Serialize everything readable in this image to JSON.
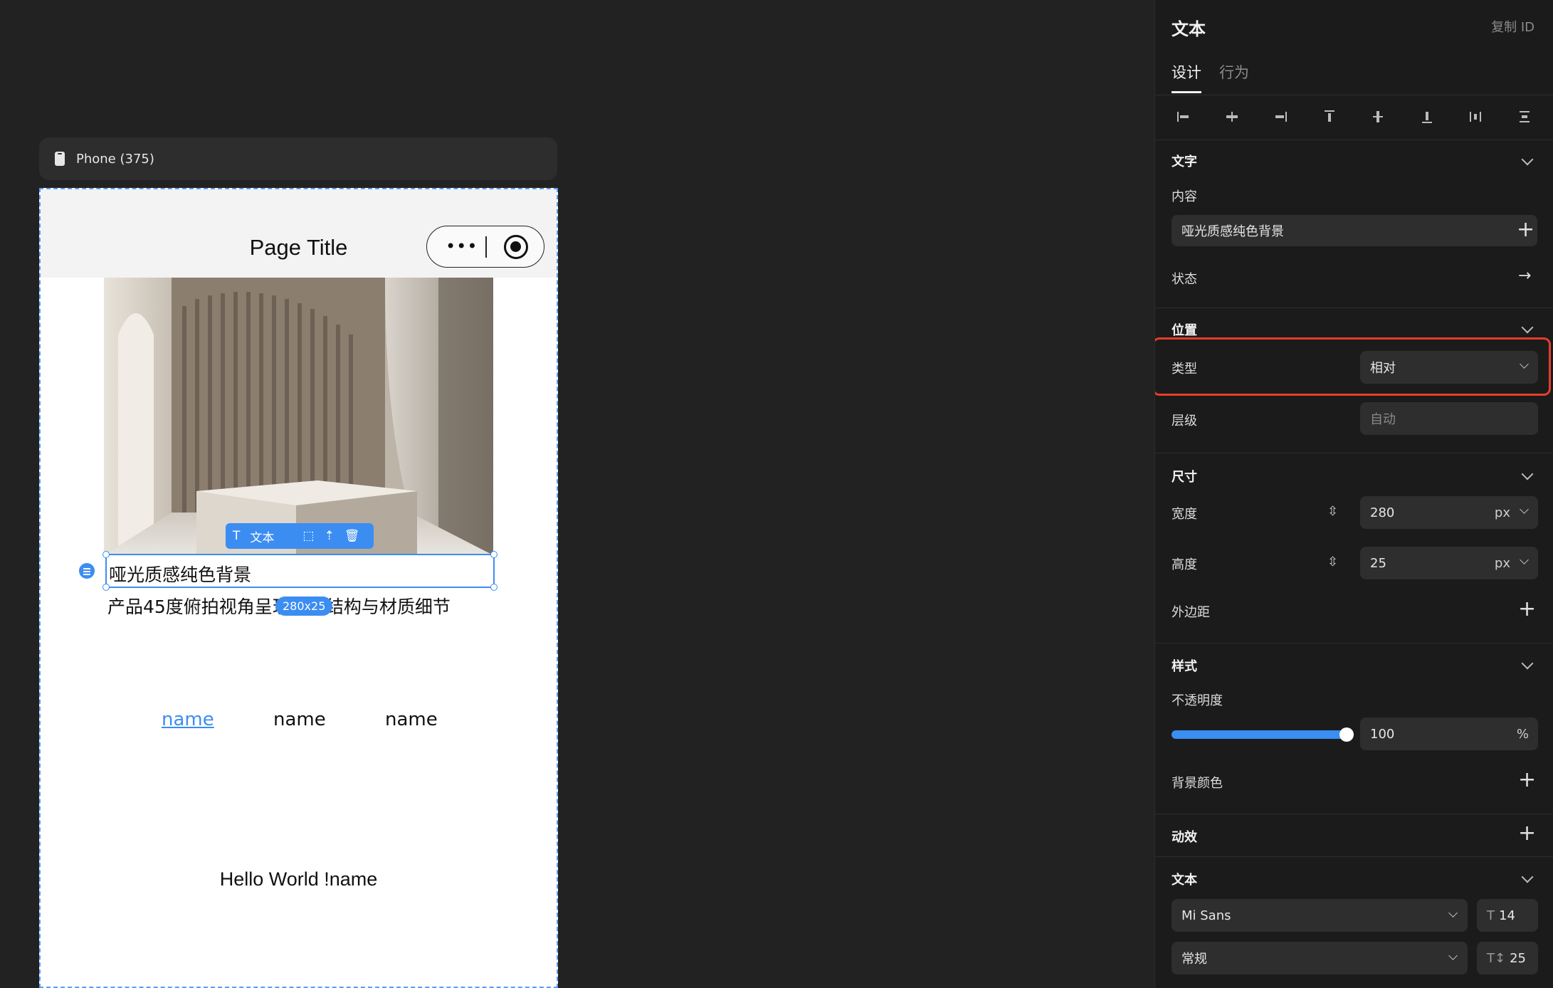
{
  "canvas": {
    "device_label": "Phone (375)",
    "page_title": "Page Title",
    "capsule_dots": "•••",
    "selected_text": "哑光质感纯色背景",
    "second_text": "产品45度俯拍视角呈现立体结构与材质细节",
    "size_badge": "280x25",
    "float_toolbar": {
      "text_label": "文本"
    },
    "nav_tabs": [
      "name",
      "name",
      "name"
    ],
    "active_tab_index": 0,
    "hello_text": "Hello World !name"
  },
  "panel": {
    "title": "文本",
    "copy_id": "复制 ID",
    "tabs": {
      "design": "设计",
      "behavior": "行为"
    },
    "text_section": {
      "title": "文字",
      "content_label": "内容",
      "content_value": "哑光质感纯色背景",
      "state_label": "状态"
    },
    "position_section": {
      "title": "位置",
      "type_label": "类型",
      "type_value": "相对",
      "level_label": "层级",
      "level_placeholder": "自动"
    },
    "size_section": {
      "title": "尺寸",
      "width_label": "宽度",
      "width_value": "280",
      "width_unit": "px",
      "height_label": "高度",
      "height_value": "25",
      "height_unit": "px",
      "margin_label": "外边距"
    },
    "style_section": {
      "title": "样式",
      "opacity_label": "不透明度",
      "opacity_value": "100",
      "opacity_unit": "%",
      "opacity_level": 1.0,
      "bg_color_label": "背景颜色"
    },
    "animation_section": {
      "title": "动效"
    },
    "font_section": {
      "title": "文本",
      "font_family": "Mi Sans",
      "font_size": "14",
      "font_weight": "常规",
      "line_height": "25"
    }
  },
  "colors": {
    "accent": "#3b8df2",
    "highlight": "#e53d2c",
    "panel_bg": "#1b1b1b",
    "canvas_bg": "#222222"
  }
}
